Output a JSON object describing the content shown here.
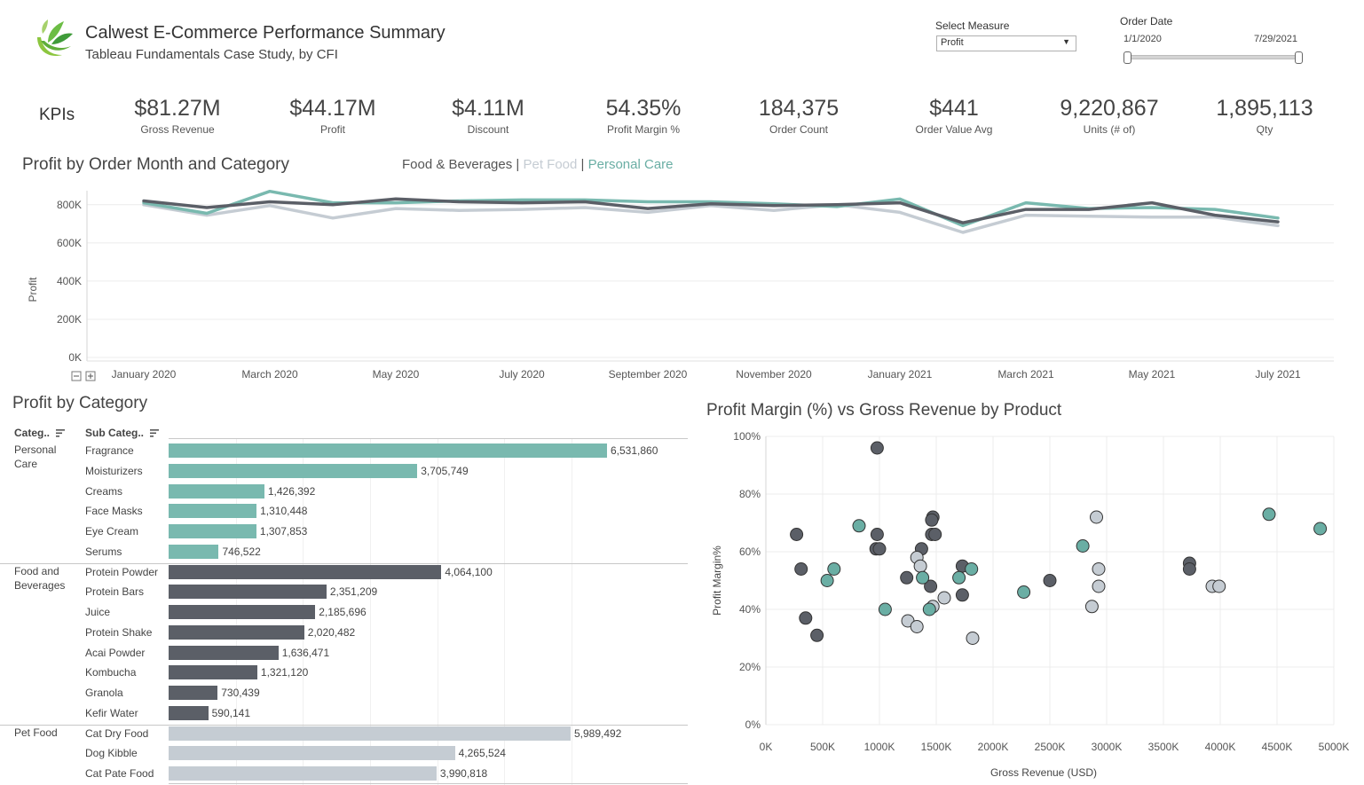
{
  "header": {
    "title": "Calwest E-Commerce Performance Summary",
    "subtitle": "Tableau Fundamentals Case Study, by CFI"
  },
  "filters": {
    "measure_label": "Select Measure",
    "measure_value": "Profit",
    "date_label": "Order Date",
    "date_start": "1/1/2020",
    "date_end": "7/29/2021"
  },
  "kpis": {
    "label": "KPIs",
    "items": [
      {
        "value": "$81.27M",
        "label": "Gross Revenue"
      },
      {
        "value": "$44.17M",
        "label": "Profit"
      },
      {
        "value": "$4.11M",
        "label": "Discount"
      },
      {
        "value": "54.35%",
        "label": "Profit Margin %"
      },
      {
        "value": "184,375",
        "label": "Order Count"
      },
      {
        "value": "$441",
        "label": "Order Value Avg"
      },
      {
        "value": "9,220,867",
        "label": "Units (# of)"
      },
      {
        "value": "1,895,113",
        "label": "Qty"
      }
    ]
  },
  "colors": {
    "food": "#5b5f67",
    "pet": "#c5ccd3",
    "personal": "#79b9af",
    "personal_dark": "#6aaea4"
  },
  "legend": {
    "food": "Food & Beverages",
    "pet": "Pet Food",
    "personal": "Personal Care",
    "separator": "|"
  },
  "chart_data": [
    {
      "type": "line",
      "title": "Profit by Order Month and Category",
      "ylabel": "Profit",
      "ylim": [
        0,
        850000
      ],
      "yticks": [
        "0K",
        "200K",
        "400K",
        "600K",
        "800K"
      ],
      "xtick_labels": [
        "January 2020",
        "March 2020",
        "May 2020",
        "July 2020",
        "September 2020",
        "November 2020",
        "January 2021",
        "March 2021",
        "May 2021",
        "July 2021"
      ],
      "x": [
        "2020-01",
        "2020-02",
        "2020-03",
        "2020-04",
        "2020-05",
        "2020-06",
        "2020-07",
        "2020-08",
        "2020-09",
        "2020-10",
        "2020-11",
        "2020-12",
        "2021-01",
        "2021-02",
        "2021-03",
        "2021-04",
        "2021-05",
        "2021-06",
        "2021-07"
      ],
      "series": [
        {
          "name": "Food & Beverages",
          "color_key": "food",
          "values": [
            820000,
            785000,
            815000,
            800000,
            830000,
            815000,
            810000,
            815000,
            780000,
            805000,
            795000,
            800000,
            810000,
            705000,
            775000,
            775000,
            810000,
            745000,
            710000
          ]
        },
        {
          "name": "Pet Food",
          "color_key": "pet",
          "values": [
            800000,
            745000,
            795000,
            730000,
            780000,
            770000,
            775000,
            785000,
            760000,
            795000,
            770000,
            800000,
            760000,
            655000,
            745000,
            740000,
            735000,
            735000,
            690000
          ]
        },
        {
          "name": "Personal Care",
          "color_key": "personal",
          "values": [
            810000,
            755000,
            870000,
            810000,
            810000,
            820000,
            825000,
            825000,
            815000,
            815000,
            805000,
            790000,
            830000,
            690000,
            810000,
            780000,
            785000,
            775000,
            730000
          ]
        }
      ]
    },
    {
      "type": "bar",
      "title": "Profit by Category",
      "col_category": "Categ..",
      "col_subcategory": "Sub Categ..",
      "xlim": [
        0,
        6900000
      ],
      "groups": [
        {
          "category": "Personal Care",
          "color_key": "personal",
          "items": [
            {
              "name": "Fragrance",
              "value": 6531860,
              "label": "6,531,860"
            },
            {
              "name": "Moisturizers",
              "value": 3705749,
              "label": "3,705,749"
            },
            {
              "name": "Creams",
              "value": 1426392,
              "label": "1,426,392"
            },
            {
              "name": "Face Masks",
              "value": 1310448,
              "label": "1,310,448"
            },
            {
              "name": "Eye Cream",
              "value": 1307853,
              "label": "1,307,853"
            },
            {
              "name": "Serums",
              "value": 746522,
              "label": "746,522"
            }
          ]
        },
        {
          "category": "Food and Beverages",
          "color_key": "food",
          "items": [
            {
              "name": "Protein Powder",
              "value": 4064100,
              "label": "4,064,100"
            },
            {
              "name": "Protein Bars",
              "value": 2351209,
              "label": "2,351,209"
            },
            {
              "name": "Juice",
              "value": 2185696,
              "label": "2,185,696"
            },
            {
              "name": "Protein Shake",
              "value": 2020482,
              "label": "2,020,482"
            },
            {
              "name": "Acai Powder",
              "value": 1636471,
              "label": "1,636,471"
            },
            {
              "name": "Kombucha",
              "value": 1321120,
              "label": "1,321,120"
            },
            {
              "name": "Granola",
              "value": 730439,
              "label": "730,439"
            },
            {
              "name": "Kefir Water",
              "value": 590141,
              "label": "590,141"
            }
          ]
        },
        {
          "category": "Pet Food",
          "color_key": "pet",
          "items": [
            {
              "name": "Cat Dry Food",
              "value": 5989492,
              "label": "5,989,492"
            },
            {
              "name": "Dog Kibble",
              "value": 4265524,
              "label": "4,265,524"
            },
            {
              "name": "Cat Pate Food",
              "value": 3990818,
              "label": "3,990,818"
            }
          ]
        }
      ]
    },
    {
      "type": "scatter",
      "title": "Profit Margin (%) vs Gross Revenue by Product",
      "xlabel": "Gross Revenue (USD)",
      "ylabel": "Profit Margin%",
      "xlim": [
        0,
        5000000
      ],
      "ylim": [
        0,
        100
      ],
      "xticks": [
        "0K",
        "500K",
        "1000K",
        "1500K",
        "2000K",
        "2500K",
        "3000K",
        "3500K",
        "4000K",
        "4500K",
        "5000K"
      ],
      "yticks": [
        "0%",
        "20%",
        "40%",
        "60%",
        "80%",
        "100%"
      ],
      "points": [
        {
          "x": 980000,
          "y": 96,
          "c": "food"
        },
        {
          "x": 270000,
          "y": 66,
          "c": "food"
        },
        {
          "x": 310000,
          "y": 54,
          "c": "food"
        },
        {
          "x": 350000,
          "y": 37,
          "c": "food"
        },
        {
          "x": 450000,
          "y": 31,
          "c": "food"
        },
        {
          "x": 980000,
          "y": 66,
          "c": "food"
        },
        {
          "x": 970000,
          "y": 61,
          "c": "food"
        },
        {
          "x": 1000000,
          "y": 61,
          "c": "food"
        },
        {
          "x": 1240000,
          "y": 51,
          "c": "food"
        },
        {
          "x": 1370000,
          "y": 61,
          "c": "food"
        },
        {
          "x": 1470000,
          "y": 72,
          "c": "food"
        },
        {
          "x": 1460000,
          "y": 71,
          "c": "food"
        },
        {
          "x": 1460000,
          "y": 66,
          "c": "food"
        },
        {
          "x": 1490000,
          "y": 66,
          "c": "food"
        },
        {
          "x": 1450000,
          "y": 48,
          "c": "food"
        },
        {
          "x": 1730000,
          "y": 55,
          "c": "food"
        },
        {
          "x": 1730000,
          "y": 45,
          "c": "food"
        },
        {
          "x": 2500000,
          "y": 50,
          "c": "food"
        },
        {
          "x": 3730000,
          "y": 56,
          "c": "food"
        },
        {
          "x": 3730000,
          "y": 54,
          "c": "food"
        },
        {
          "x": 1330000,
          "y": 58,
          "c": "pet"
        },
        {
          "x": 1360000,
          "y": 55,
          "c": "pet"
        },
        {
          "x": 1250000,
          "y": 36,
          "c": "pet"
        },
        {
          "x": 1330000,
          "y": 34,
          "c": "pet"
        },
        {
          "x": 1470000,
          "y": 41,
          "c": "pet"
        },
        {
          "x": 1570000,
          "y": 44,
          "c": "pet"
        },
        {
          "x": 1820000,
          "y": 30,
          "c": "pet"
        },
        {
          "x": 2910000,
          "y": 72,
          "c": "pet"
        },
        {
          "x": 2930000,
          "y": 54,
          "c": "pet"
        },
        {
          "x": 2930000,
          "y": 48,
          "c": "pet"
        },
        {
          "x": 2870000,
          "y": 41,
          "c": "pet"
        },
        {
          "x": 3930000,
          "y": 48,
          "c": "pet"
        },
        {
          "x": 3990000,
          "y": 48,
          "c": "pet"
        },
        {
          "x": 820000,
          "y": 69,
          "c": "personal"
        },
        {
          "x": 600000,
          "y": 54,
          "c": "personal"
        },
        {
          "x": 540000,
          "y": 50,
          "c": "personal"
        },
        {
          "x": 1050000,
          "y": 40,
          "c": "personal"
        },
        {
          "x": 1380000,
          "y": 51,
          "c": "personal"
        },
        {
          "x": 1440000,
          "y": 40,
          "c": "personal"
        },
        {
          "x": 1700000,
          "y": 51,
          "c": "personal"
        },
        {
          "x": 1810000,
          "y": 54,
          "c": "personal"
        },
        {
          "x": 2270000,
          "y": 46,
          "c": "personal"
        },
        {
          "x": 2790000,
          "y": 62,
          "c": "personal"
        },
        {
          "x": 4430000,
          "y": 73,
          "c": "personal"
        },
        {
          "x": 4880000,
          "y": 68,
          "c": "personal"
        }
      ]
    }
  ]
}
